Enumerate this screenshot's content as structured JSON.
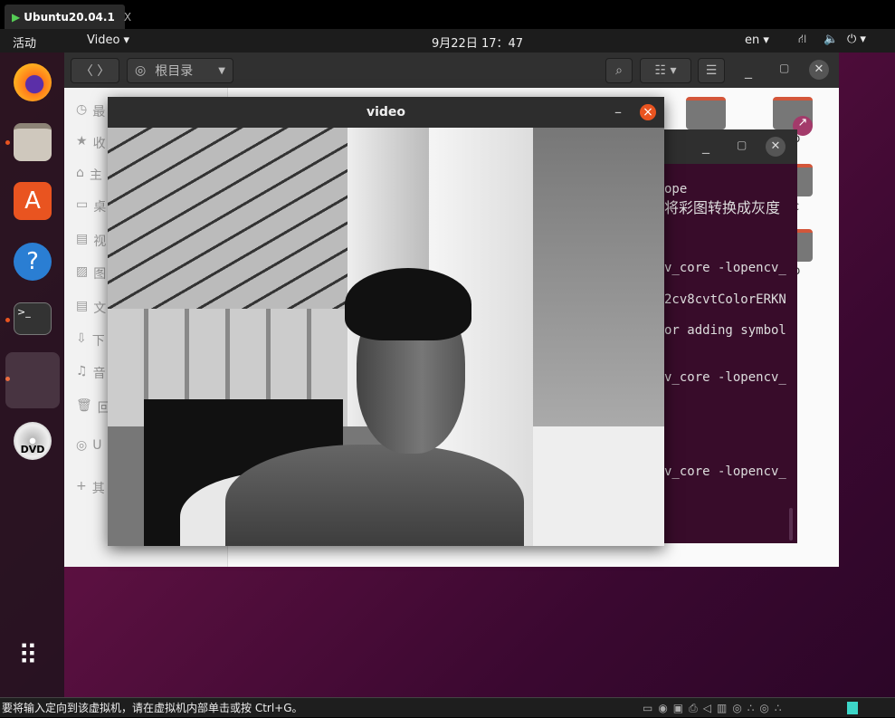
{
  "vm": {
    "tab_title": "Ubuntu20.04.1",
    "tab_close": "X",
    "status_message": "要将输入定向到该虚拟机，请在虚拟机内部单击或按 Ctrl+G。"
  },
  "topbar": {
    "activities": "活动",
    "app_menu": "Video ▾",
    "clock": "9月22日  17：47",
    "lang": "en ▾",
    "power": "⏻ ▾"
  },
  "files": {
    "location": "根目录",
    "sidebar": [
      {
        "icon": "clock-icon",
        "glyph": "◷",
        "label": "最"
      },
      {
        "icon": "star-icon",
        "glyph": "★",
        "label": "收"
      },
      {
        "icon": "home-icon",
        "glyph": "⌂",
        "label": "主"
      },
      {
        "icon": "desktop-icon",
        "glyph": "▭",
        "label": "桌"
      },
      {
        "icon": "video-icon",
        "glyph": "▤",
        "label": "视"
      },
      {
        "icon": "picture-icon",
        "glyph": "▨",
        "label": "图"
      },
      {
        "icon": "document-icon",
        "glyph": "▤",
        "label": "文"
      },
      {
        "icon": "download-icon",
        "glyph": "⇩",
        "label": "下"
      },
      {
        "icon": "music-icon",
        "glyph": "♫",
        "label": "音"
      },
      {
        "icon": "trash-icon",
        "glyph": "🗑",
        "label": "回"
      },
      {
        "icon": "disc-icon",
        "glyph": "◎",
        "label": "U"
      },
      {
        "icon": "plus-icon",
        "glyph": "+",
        "label": "其"
      }
    ],
    "folder_labels": [
      "p",
      "c",
      "p"
    ]
  },
  "terminal": {
    "lines": [
      "ope",
      "将彩图转换成灰度",
      "v_core -lopencv_",
      "2cv8cvtColorERKN",
      "or adding symbol",
      "v_core -lopencv_",
      "v_core -lopencv_"
    ]
  },
  "video": {
    "title": "video",
    "minimize": "–",
    "close": "×"
  },
  "colors": {
    "accent": "#e95420",
    "terminal_bg": "#380c2a"
  }
}
